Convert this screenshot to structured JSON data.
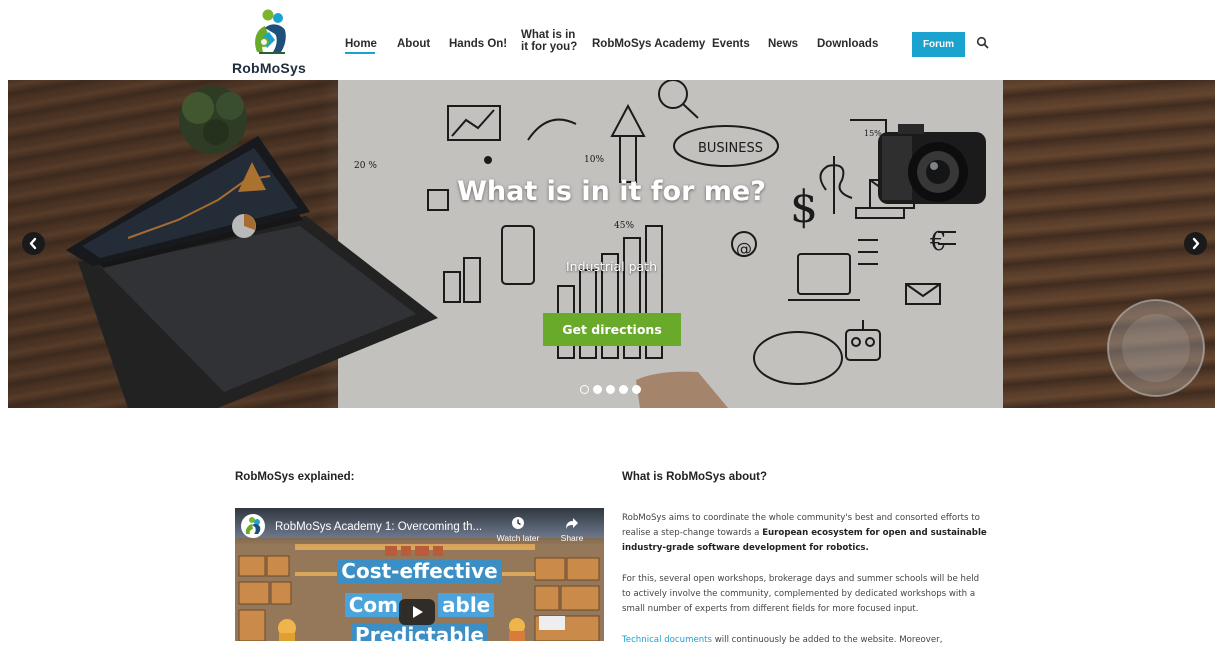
{
  "brand": {
    "name": "RobMoSys"
  },
  "nav": {
    "items": [
      {
        "label": "Home",
        "active": true
      },
      {
        "label": "About"
      },
      {
        "label": "Hands On!"
      },
      {
        "label_line1": "What is in",
        "label_line2": "it for you?"
      },
      {
        "label": "RobMoSys Academy"
      },
      {
        "label": "Events"
      },
      {
        "label": "News"
      },
      {
        "label": "Downloads"
      }
    ],
    "forum_label": "Forum"
  },
  "hero": {
    "title": "What is in it for me?",
    "subtitle": "Industrial path",
    "cta_label": "Get directions",
    "slide_count": 5,
    "active_slide": 1,
    "paper_words": [
      "BUSINESS",
      "20 %",
      "10%",
      "45%",
      "15%"
    ]
  },
  "left": {
    "title": "RobMoSys explained:",
    "video": {
      "title": "RobMoSys Academy 1: Overcoming th...",
      "watch_later": "Watch later",
      "share": "Share",
      "caption1": "Cost-effective",
      "caption2": "Com",
      "caption2b": "able",
      "caption3": "Predictable"
    }
  },
  "right": {
    "title": "What is RobMoSys about?",
    "p1_a": "RobMoSys aims to coordinate the whole community's best and consorted efforts to realise a step-change towards a ",
    "p1_b": "European ecosystem for open and sustainable industry-grade software development for robotics.",
    "p2": "For this, several open workshops, brokerage days and summer schools will be held to actively involve the community, complemented by dedicated workshops with a small number of experts from different fields for more focused input.",
    "p3_link": "Technical documents",
    "p3_rest": " will continuously be added to the website. Moreover,"
  },
  "colors": {
    "accent": "#1aa3cf",
    "cta_green": "#6aaa2a",
    "text_dark": "#222222"
  }
}
